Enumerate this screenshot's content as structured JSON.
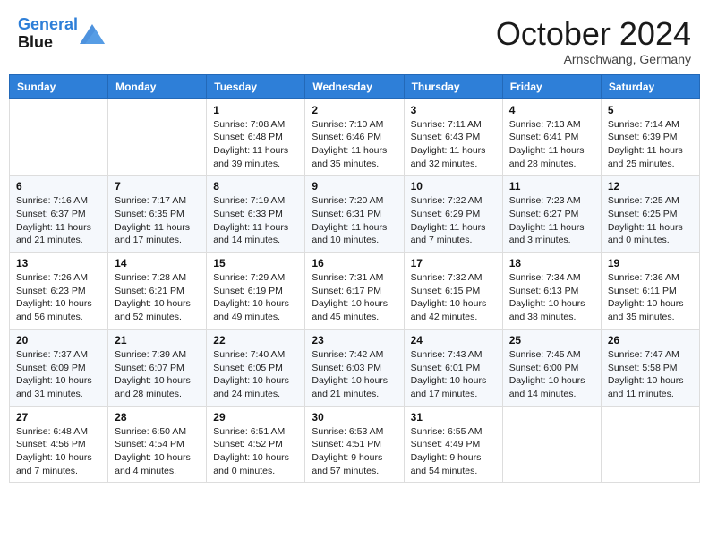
{
  "header": {
    "logo_line1": "General",
    "logo_line2": "Blue",
    "month": "October 2024",
    "location": "Arnschwang, Germany"
  },
  "days_of_week": [
    "Sunday",
    "Monday",
    "Tuesday",
    "Wednesday",
    "Thursday",
    "Friday",
    "Saturday"
  ],
  "weeks": [
    [
      {
        "day": "",
        "sunrise": "",
        "sunset": "",
        "daylight": ""
      },
      {
        "day": "",
        "sunrise": "",
        "sunset": "",
        "daylight": ""
      },
      {
        "day": "1",
        "sunrise": "Sunrise: 7:08 AM",
        "sunset": "Sunset: 6:48 PM",
        "daylight": "Daylight: 11 hours and 39 minutes."
      },
      {
        "day": "2",
        "sunrise": "Sunrise: 7:10 AM",
        "sunset": "Sunset: 6:46 PM",
        "daylight": "Daylight: 11 hours and 35 minutes."
      },
      {
        "day": "3",
        "sunrise": "Sunrise: 7:11 AM",
        "sunset": "Sunset: 6:43 PM",
        "daylight": "Daylight: 11 hours and 32 minutes."
      },
      {
        "day": "4",
        "sunrise": "Sunrise: 7:13 AM",
        "sunset": "Sunset: 6:41 PM",
        "daylight": "Daylight: 11 hours and 28 minutes."
      },
      {
        "day": "5",
        "sunrise": "Sunrise: 7:14 AM",
        "sunset": "Sunset: 6:39 PM",
        "daylight": "Daylight: 11 hours and 25 minutes."
      }
    ],
    [
      {
        "day": "6",
        "sunrise": "Sunrise: 7:16 AM",
        "sunset": "Sunset: 6:37 PM",
        "daylight": "Daylight: 11 hours and 21 minutes."
      },
      {
        "day": "7",
        "sunrise": "Sunrise: 7:17 AM",
        "sunset": "Sunset: 6:35 PM",
        "daylight": "Daylight: 11 hours and 17 minutes."
      },
      {
        "day": "8",
        "sunrise": "Sunrise: 7:19 AM",
        "sunset": "Sunset: 6:33 PM",
        "daylight": "Daylight: 11 hours and 14 minutes."
      },
      {
        "day": "9",
        "sunrise": "Sunrise: 7:20 AM",
        "sunset": "Sunset: 6:31 PM",
        "daylight": "Daylight: 11 hours and 10 minutes."
      },
      {
        "day": "10",
        "sunrise": "Sunrise: 7:22 AM",
        "sunset": "Sunset: 6:29 PM",
        "daylight": "Daylight: 11 hours and 7 minutes."
      },
      {
        "day": "11",
        "sunrise": "Sunrise: 7:23 AM",
        "sunset": "Sunset: 6:27 PM",
        "daylight": "Daylight: 11 hours and 3 minutes."
      },
      {
        "day": "12",
        "sunrise": "Sunrise: 7:25 AM",
        "sunset": "Sunset: 6:25 PM",
        "daylight": "Daylight: 11 hours and 0 minutes."
      }
    ],
    [
      {
        "day": "13",
        "sunrise": "Sunrise: 7:26 AM",
        "sunset": "Sunset: 6:23 PM",
        "daylight": "Daylight: 10 hours and 56 minutes."
      },
      {
        "day": "14",
        "sunrise": "Sunrise: 7:28 AM",
        "sunset": "Sunset: 6:21 PM",
        "daylight": "Daylight: 10 hours and 52 minutes."
      },
      {
        "day": "15",
        "sunrise": "Sunrise: 7:29 AM",
        "sunset": "Sunset: 6:19 PM",
        "daylight": "Daylight: 10 hours and 49 minutes."
      },
      {
        "day": "16",
        "sunrise": "Sunrise: 7:31 AM",
        "sunset": "Sunset: 6:17 PM",
        "daylight": "Daylight: 10 hours and 45 minutes."
      },
      {
        "day": "17",
        "sunrise": "Sunrise: 7:32 AM",
        "sunset": "Sunset: 6:15 PM",
        "daylight": "Daylight: 10 hours and 42 minutes."
      },
      {
        "day": "18",
        "sunrise": "Sunrise: 7:34 AM",
        "sunset": "Sunset: 6:13 PM",
        "daylight": "Daylight: 10 hours and 38 minutes."
      },
      {
        "day": "19",
        "sunrise": "Sunrise: 7:36 AM",
        "sunset": "Sunset: 6:11 PM",
        "daylight": "Daylight: 10 hours and 35 minutes."
      }
    ],
    [
      {
        "day": "20",
        "sunrise": "Sunrise: 7:37 AM",
        "sunset": "Sunset: 6:09 PM",
        "daylight": "Daylight: 10 hours and 31 minutes."
      },
      {
        "day": "21",
        "sunrise": "Sunrise: 7:39 AM",
        "sunset": "Sunset: 6:07 PM",
        "daylight": "Daylight: 10 hours and 28 minutes."
      },
      {
        "day": "22",
        "sunrise": "Sunrise: 7:40 AM",
        "sunset": "Sunset: 6:05 PM",
        "daylight": "Daylight: 10 hours and 24 minutes."
      },
      {
        "day": "23",
        "sunrise": "Sunrise: 7:42 AM",
        "sunset": "Sunset: 6:03 PM",
        "daylight": "Daylight: 10 hours and 21 minutes."
      },
      {
        "day": "24",
        "sunrise": "Sunrise: 7:43 AM",
        "sunset": "Sunset: 6:01 PM",
        "daylight": "Daylight: 10 hours and 17 minutes."
      },
      {
        "day": "25",
        "sunrise": "Sunrise: 7:45 AM",
        "sunset": "Sunset: 6:00 PM",
        "daylight": "Daylight: 10 hours and 14 minutes."
      },
      {
        "day": "26",
        "sunrise": "Sunrise: 7:47 AM",
        "sunset": "Sunset: 5:58 PM",
        "daylight": "Daylight: 10 hours and 11 minutes."
      }
    ],
    [
      {
        "day": "27",
        "sunrise": "Sunrise: 6:48 AM",
        "sunset": "Sunset: 4:56 PM",
        "daylight": "Daylight: 10 hours and 7 minutes."
      },
      {
        "day": "28",
        "sunrise": "Sunrise: 6:50 AM",
        "sunset": "Sunset: 4:54 PM",
        "daylight": "Daylight: 10 hours and 4 minutes."
      },
      {
        "day": "29",
        "sunrise": "Sunrise: 6:51 AM",
        "sunset": "Sunset: 4:52 PM",
        "daylight": "Daylight: 10 hours and 0 minutes."
      },
      {
        "day": "30",
        "sunrise": "Sunrise: 6:53 AM",
        "sunset": "Sunset: 4:51 PM",
        "daylight": "Daylight: 9 hours and 57 minutes."
      },
      {
        "day": "31",
        "sunrise": "Sunrise: 6:55 AM",
        "sunset": "Sunset: 4:49 PM",
        "daylight": "Daylight: 9 hours and 54 minutes."
      },
      {
        "day": "",
        "sunrise": "",
        "sunset": "",
        "daylight": ""
      },
      {
        "day": "",
        "sunrise": "",
        "sunset": "",
        "daylight": ""
      }
    ]
  ]
}
